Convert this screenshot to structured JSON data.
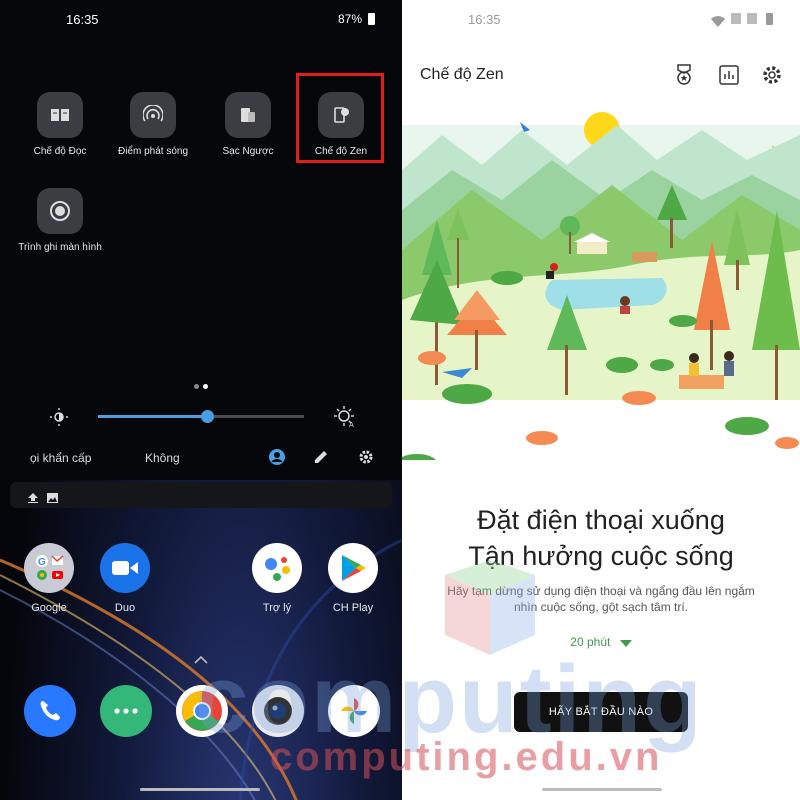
{
  "left": {
    "status": {
      "time": "16:35",
      "battery": "87%"
    },
    "tiles": [
      {
        "label": "Chế độ Đọc",
        "icon": "book-icon"
      },
      {
        "label": "Điểm phát sóng",
        "icon": "hotspot-icon"
      },
      {
        "label": "Sạc Ngược",
        "icon": "reverse-charge-icon"
      },
      {
        "label": "Chế độ Zen",
        "icon": "zen-mode-icon"
      },
      {
        "label": "Trình ghi màn hình",
        "icon": "screen-record-icon"
      }
    ],
    "brightness": {
      "level": 0.53
    },
    "qs_footer": {
      "emergency": "ọi khẩn cấp",
      "carrier": "Không"
    },
    "apps": [
      {
        "label": "Google",
        "icon": "google-folder-icon"
      },
      {
        "label": "Duo",
        "icon": "duo-icon"
      },
      {
        "label": "Trợ lý",
        "icon": "assistant-icon"
      },
      {
        "label": "CH Play",
        "icon": "play-store-icon"
      }
    ],
    "dock": [
      "phone-icon",
      "apps-icon",
      "chrome-icon",
      "camera-icon",
      "photos-icon"
    ]
  },
  "right": {
    "status": {
      "time": "16:35"
    },
    "title": "Chế độ Zen",
    "headline_1": "Đặt điện thoại xuống",
    "headline_2": "Tận hưởng cuộc sống",
    "subtitle": "Hãy tạm dừng sử dụng điện thoại và ngẩng đầu lên ngắm nhìn cuộc sống, gột sạch tâm trí.",
    "duration": "20 phút",
    "start_button": "HÃY BẮT ĐẦU NÀO"
  },
  "watermark": {
    "big": "computing",
    "small": "computing.edu.vn"
  },
  "colors": {
    "accent_blue": "#4a9ee6",
    "highlight_red": "#e21d1d",
    "zen_green": "#3f9a4a"
  }
}
